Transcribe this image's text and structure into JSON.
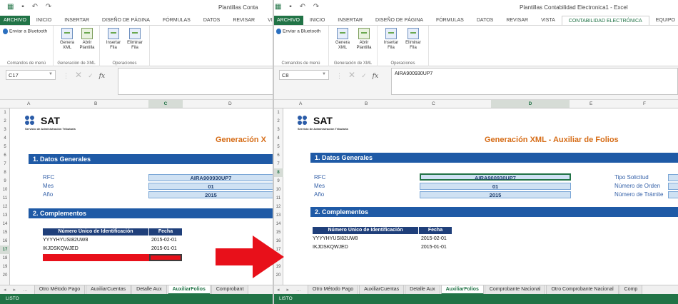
{
  "left": {
    "window_title": "Plantillas Conta",
    "tabs": [
      "ARCHIVO",
      "INICIO",
      "INSERTAR",
      "DISEÑO DE PÁGINA",
      "FÓRMULAS",
      "DATOS",
      "REVISAR",
      "VISTA"
    ],
    "ribbon": {
      "bluetooth": "Enviar a Bluetooth",
      "menu_group": "Comandos de menú",
      "xml_group": "Generación de XML",
      "ops_group": "Operaciones",
      "buttons": [
        {
          "line1": "Genera",
          "line2": "XML"
        },
        {
          "line1": "Abrir",
          "line2": "Plantilla"
        },
        {
          "line1": "Insertar",
          "line2": "Fila"
        },
        {
          "line1": "Eliminar",
          "line2": "Fila"
        }
      ]
    },
    "name_box": "C17",
    "formula": "",
    "columns": [
      "A",
      "B",
      "C",
      "D"
    ],
    "rows": [
      "1",
      "2",
      "3",
      "4",
      "5",
      "6",
      "7",
      "8",
      "9",
      "10",
      "11",
      "12",
      "13",
      "14",
      "15",
      "16",
      "17",
      "18",
      "19",
      "20"
    ],
    "selected_row": "17",
    "sheet": {
      "logo_text": "SAT",
      "logo_sub": "Servicio de Administración Tributaria",
      "title": "Generación X",
      "section1": "1. Datos Generales",
      "labels": [
        "RFC",
        "Mes",
        "Año"
      ],
      "values": [
        "AIRA900930UP7",
        "01",
        "2015"
      ],
      "section2": "2. Complementos",
      "table_headers": [
        "Número Único de Identificación",
        "Fecha"
      ],
      "table_rows": [
        [
          "YYYYHYUSI82UW8",
          "2015-02-01"
        ],
        [
          "IKJDSKQWJED",
          "2015-01-01"
        ]
      ]
    },
    "sheet_tabs": [
      "Otro Método Pago",
      "AuxiliarCuentas",
      "Detalle Aux",
      "AuxiliarFolios",
      "Comprobant"
    ],
    "active_sheet": "AuxiliarFolios",
    "status": "LISTO"
  },
  "right": {
    "window_title": "Plantillas Contabilidad Electronica1 - Excel",
    "tabs": [
      "ARCHIVO",
      "INICIO",
      "INSERTAR",
      "DISEÑO DE PÁGINA",
      "FÓRMULAS",
      "DATOS",
      "REVISAR",
      "VISTA",
      "CONTABILIDAD ELECTRÓNICA",
      "EQUIPO"
    ],
    "active_tab": "CONTABILIDAD ELECTRÓNICA",
    "ribbon": {
      "bluetooth": "Enviar a Bluetooth",
      "menu_group": "Comandos de menú",
      "xml_group": "Generación de XML",
      "ops_group": "Operaciones",
      "buttons": [
        {
          "line1": "Genera",
          "line2": "XML"
        },
        {
          "line1": "Abrir",
          "line2": "Plantilla"
        },
        {
          "line1": "Insertar",
          "line2": "Fila"
        },
        {
          "line1": "Eliminar",
          "line2": "Fila"
        }
      ]
    },
    "name_box": "C8",
    "formula": "AIRA900930UP7",
    "columns": [
      "A",
      "B",
      "C",
      "D",
      "E",
      "F"
    ],
    "rows": [
      "1",
      "2",
      "3",
      "4",
      "5",
      "6",
      "7",
      "8",
      "9",
      "10",
      "11",
      "12",
      "13",
      "14",
      "15",
      "16",
      "17",
      "18",
      "19",
      "20"
    ],
    "selected_row": "8",
    "sheet": {
      "logo_text": "SAT",
      "logo_sub": "Servicio de Administración Tributaria",
      "title": "Generación XML - Auxiliar de Folios",
      "section1": "1. Datos Generales",
      "labels": [
        "RFC",
        "Mes",
        "Año"
      ],
      "values": [
        "AIRA900930UP7",
        "01",
        "2015"
      ],
      "right_labels": [
        "Tipo Solicitud",
        "Número de Orden",
        "Número de Trámite"
      ],
      "section2": "2. Complementos",
      "table_headers": [
        "Número Único de Identificación",
        "Fecha"
      ],
      "table_rows": [
        [
          "YYYYHYUSI82UW8",
          "2015-02-01"
        ],
        [
          "IKJDSKQWJED",
          "2015-01-01"
        ]
      ]
    },
    "sheet_tabs": [
      "Otro Método Pago",
      "AuxiliarCuentas",
      "Detalle Aux",
      "AuxiliarFolios",
      "Comprobante Nacional",
      "Otro Comprobante Nacional",
      "Comp"
    ],
    "active_sheet": "AuxiliarFolios",
    "status": "LISTO"
  },
  "colors": {
    "excel_green": "#217346",
    "sat_blue": "#1f5aa6",
    "title_orange": "#d66d18",
    "red": "#e8101a"
  }
}
